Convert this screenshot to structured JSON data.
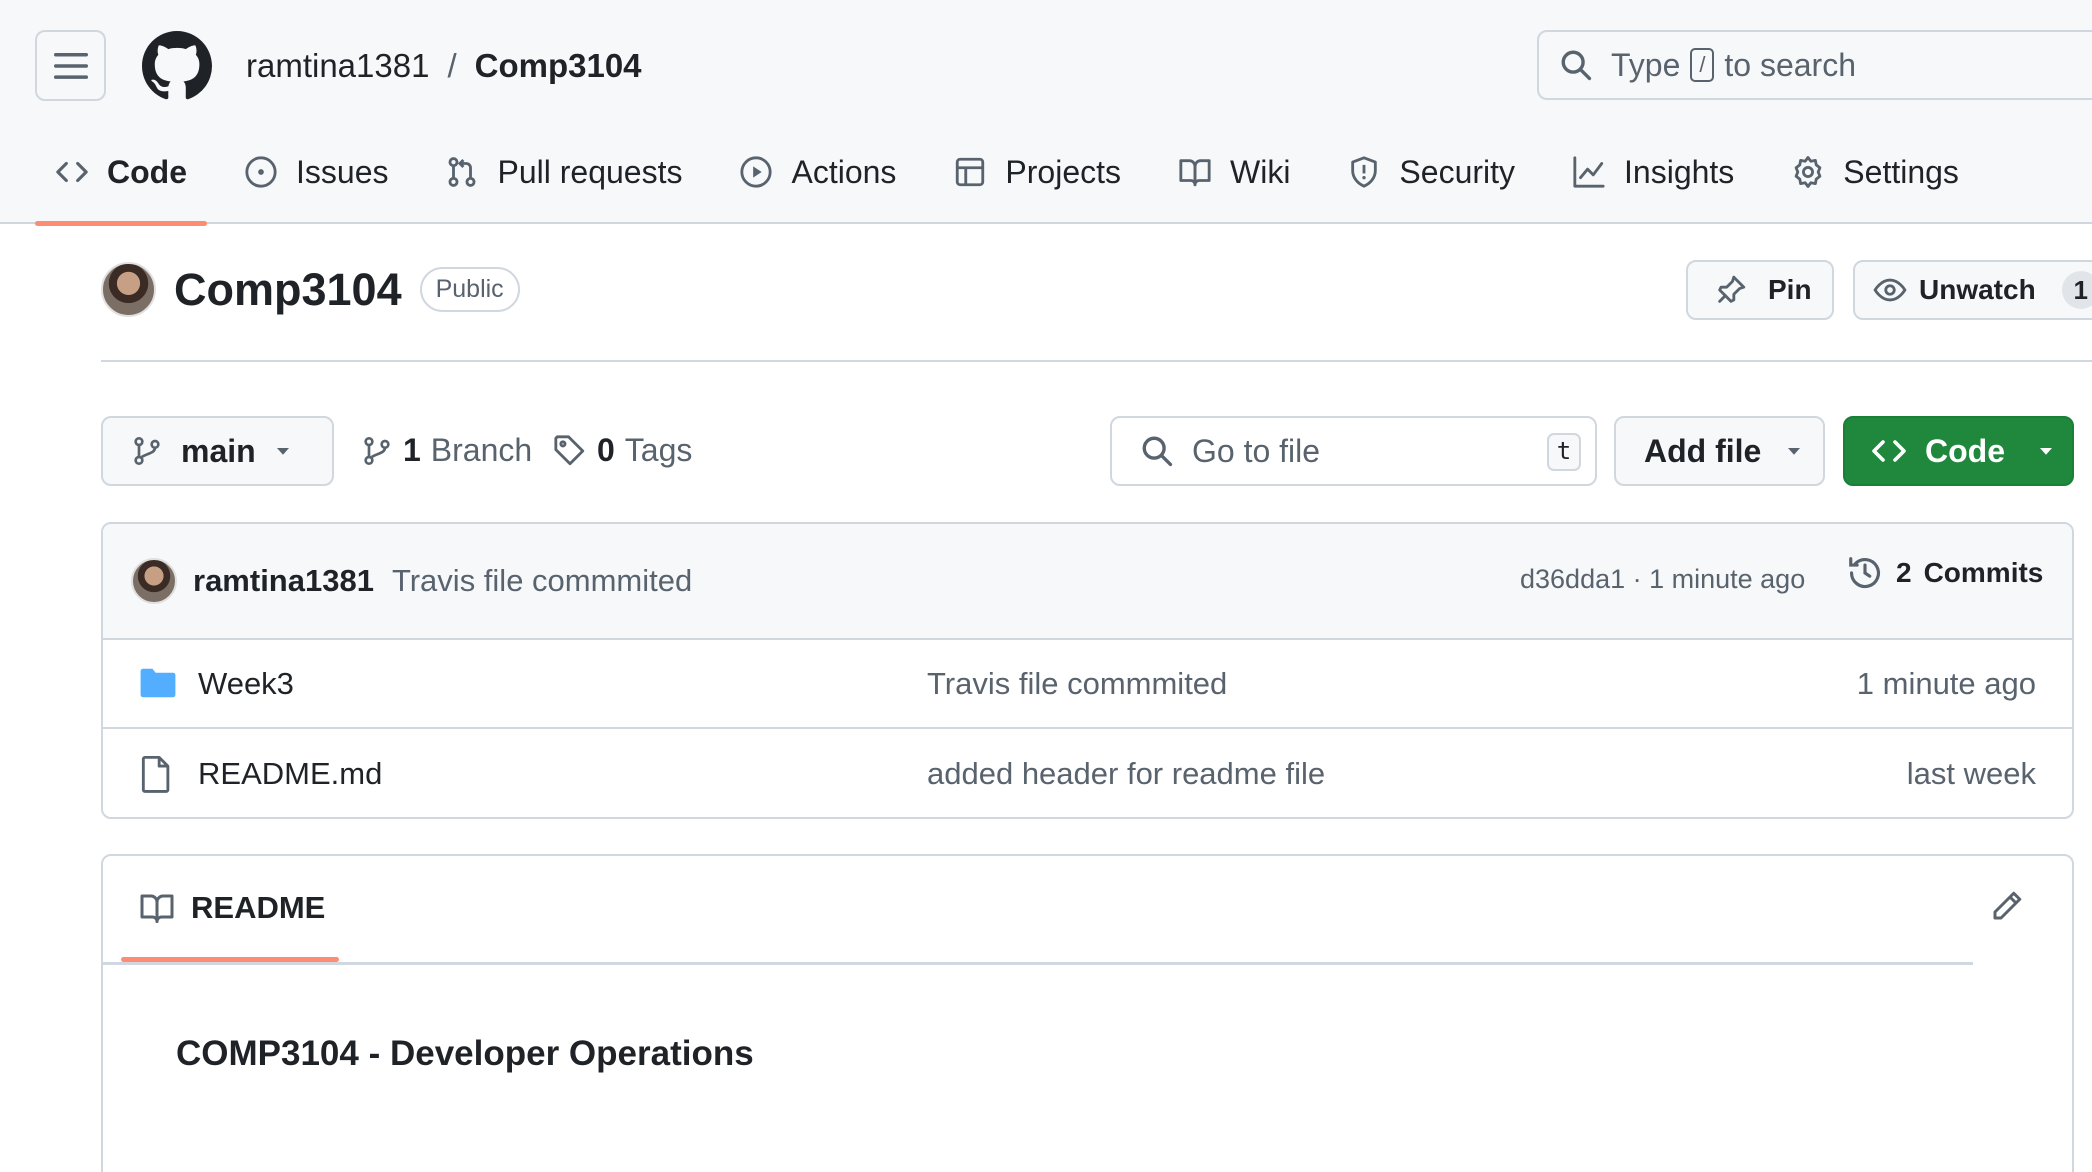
{
  "breadcrumb": {
    "owner": "ramtina1381",
    "separator": "/",
    "repo": "Comp3104"
  },
  "search": {
    "prefix": "Type",
    "key": "/",
    "suffix": "to search"
  },
  "tabs": [
    {
      "label": "Code",
      "icon": "code-icon",
      "selected": true
    },
    {
      "label": "Issues",
      "icon": "issue-icon"
    },
    {
      "label": "Pull requests",
      "icon": "pull-request-icon"
    },
    {
      "label": "Actions",
      "icon": "play-icon"
    },
    {
      "label": "Projects",
      "icon": "table-icon"
    },
    {
      "label": "Wiki",
      "icon": "book-icon"
    },
    {
      "label": "Security",
      "icon": "shield-icon"
    },
    {
      "label": "Insights",
      "icon": "graph-icon"
    },
    {
      "label": "Settings",
      "icon": "gear-icon"
    }
  ],
  "repo": {
    "name": "Comp3104",
    "visibility": "Public"
  },
  "actions": {
    "pin": "Pin",
    "unwatch": "Unwatch",
    "watch_count": "1"
  },
  "branch": {
    "current": "main",
    "branch_count": "1",
    "branch_label": "Branch",
    "tag_count": "0",
    "tag_label": "Tags"
  },
  "goto_file": {
    "placeholder": "Go to file",
    "shortcut": "t"
  },
  "add_file": "Add file",
  "code_button": "Code",
  "latest_commit": {
    "author": "ramtina1381",
    "message": "Travis file commmited",
    "meta": "d36dda1 · 1 minute ago",
    "commits_count": "2",
    "commits_label": "Commits"
  },
  "files": [
    {
      "name": "Week3",
      "type": "folder",
      "message": "Travis file commmited",
      "date": "1 minute ago"
    },
    {
      "name": "README.md",
      "type": "file",
      "message": "added header for readme file",
      "date": "last week"
    }
  ],
  "readme": {
    "tab_label": "README",
    "heading": "COMP3104 - Developer Operations"
  },
  "colors": {
    "accent_underline": "#fd8c73",
    "code_button": "#1f883d",
    "folder": "#54aeff"
  }
}
